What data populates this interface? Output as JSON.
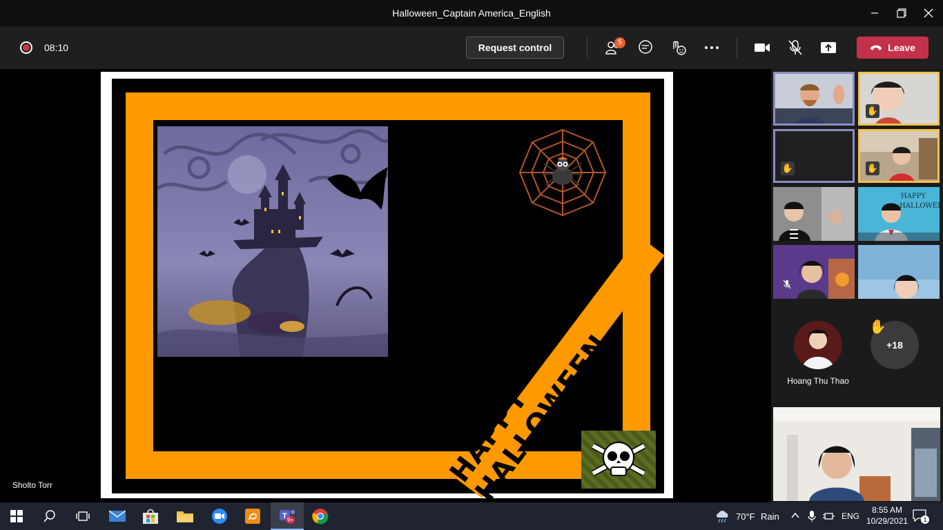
{
  "window": {
    "title": "Halloween_Captain America_English"
  },
  "toolbar": {
    "timer": "08:10",
    "request_control_label": "Request control",
    "participants_badge": "5",
    "leave_label": "Leave"
  },
  "stage": {
    "presenter_name": "Sholto Torr",
    "slide_banner_text": "HAPPY HALLOWEEN"
  },
  "panel": {
    "attendee_name": "Hoang Thu Thao",
    "more_count": "+18"
  },
  "taskbar": {
    "weather_temp": "70°F",
    "weather_desc": "Rain",
    "language": "ENG",
    "time": "8:55 AM",
    "date": "10/29/2021",
    "teams_badge": "9+",
    "notifications_count": "1"
  },
  "colors": {
    "leave": "#c4314b",
    "frame_orange": "#ff9900",
    "tile_highlight_blue": "#8b8cc7",
    "tile_highlight_gold": "#f3c14a"
  }
}
